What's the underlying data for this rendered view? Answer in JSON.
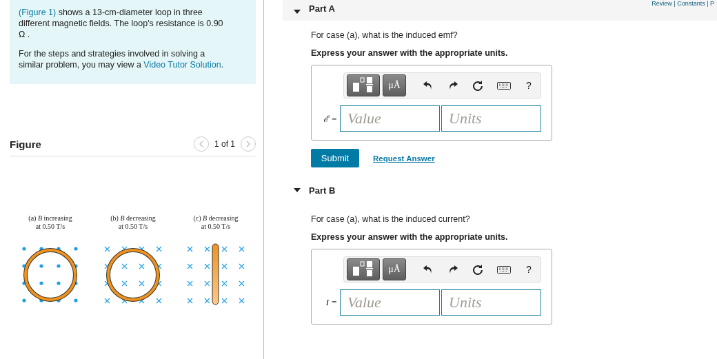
{
  "header_links": "Review | Constants | P",
  "intro": {
    "text": "shows a 13-cm-diameter loop in three different magnetic fields. The loop's resistance is 0.90  Ω .",
    "figure_link": "(Figure 1)",
    "strategy": "For the steps and strategies involved in solving a similar problem, you may view a",
    "video_link": "Video Tutor Solution",
    "end": "."
  },
  "figure": {
    "title": "Figure",
    "pager": "1 of 1",
    "prev_disabled": true,
    "next_disabled": true,
    "panels": [
      {
        "kind": "dots",
        "label": "(a) *B* increasing",
        "rate": "at 0.50 T/s"
      },
      {
        "kind": "crosses",
        "label": "(b) *B* decreasing",
        "rate": "at 0.50 T/s"
      },
      {
        "kind": "rod",
        "label": "(c) *B* decreasing",
        "rate": "at 0.50 T/s"
      }
    ]
  },
  "parts": [
    {
      "title": "Part A",
      "expanded": true,
      "question": "For case (a), what is the induced emf?",
      "instruction": "Express your answer with the appropriate units.",
      "symbol": "ℰ =",
      "value_placeholder": "Value",
      "units_placeholder": "Units",
      "unit_button": "μÅ",
      "help": "?",
      "submit": "Submit",
      "request": "Request Answer"
    },
    {
      "title": "Part B",
      "expanded": true,
      "question": "For case (a), what is the induced current?",
      "instruction": "Express your answer with the appropriate units.",
      "symbol": "I =",
      "value_placeholder": "Value",
      "units_placeholder": "Units",
      "unit_button": "μÅ",
      "help": "?"
    }
  ]
}
